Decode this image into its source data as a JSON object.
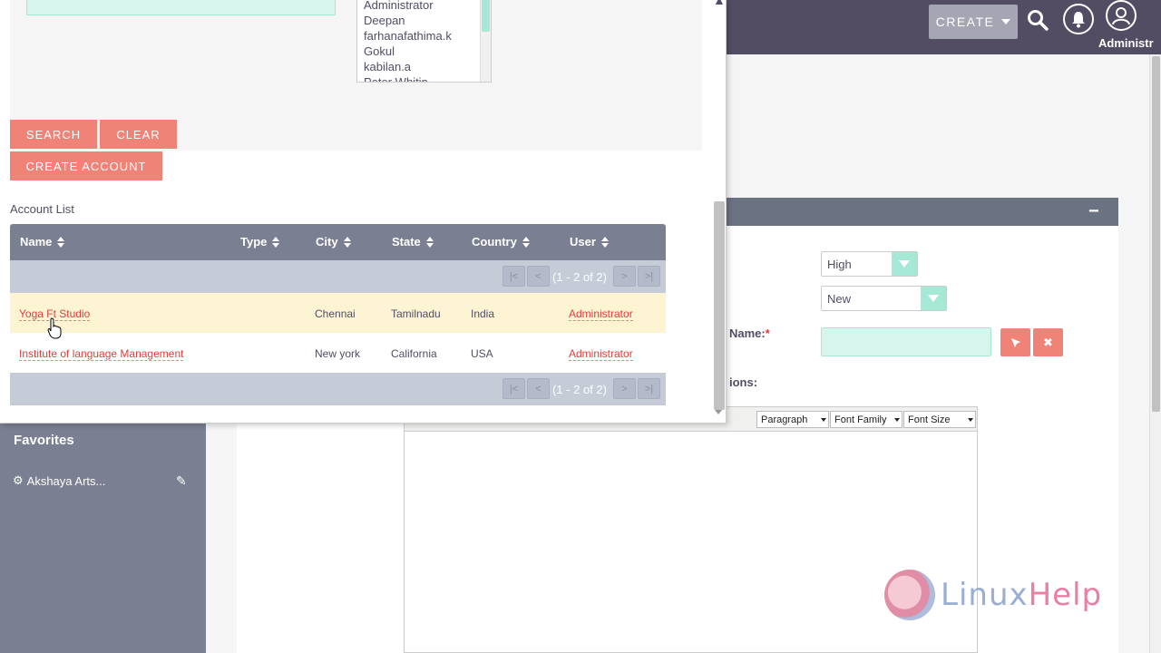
{
  "header": {
    "create_label": "CREATE",
    "user_label": "Administr"
  },
  "sidebar": {
    "favorites_title": "Favorites",
    "favorite_item": "Akshaya Arts..."
  },
  "form": {
    "priority_value": "High",
    "status_value": "New",
    "name_label": "Name:",
    "required_mark": "*",
    "description_label": "ions:"
  },
  "editor": {
    "paragraph": "Paragraph",
    "font_family": "Font Family",
    "font_size": "Font Size"
  },
  "watermark": {
    "text_a": "Linux",
    "text_b": "Help"
  },
  "popup": {
    "users": [
      "Administrator",
      "Deepan",
      "farhanafathima.k",
      "Gokul",
      "kabilan.a",
      "Peter Whitin"
    ],
    "search_label": "SEARCH",
    "clear_label": "CLEAR",
    "create_account_label": "CREATE ACCOUNT",
    "list_title": "Account List",
    "columns": {
      "name": "Name",
      "type": "Type",
      "city": "City",
      "state": "State",
      "country": "Country",
      "user": "User"
    },
    "pagination_text": "(1 - 2 of 2)",
    "rows": [
      {
        "name": "Yoga Ft Studio",
        "type": "",
        "city": "Chennai",
        "state": "Tamilnadu",
        "country": "India",
        "user": "Administrator"
      },
      {
        "name": "Institute of language Management",
        "type": "",
        "city": "New york",
        "state": "California",
        "country": "USA",
        "user": "Administrator"
      }
    ]
  }
}
